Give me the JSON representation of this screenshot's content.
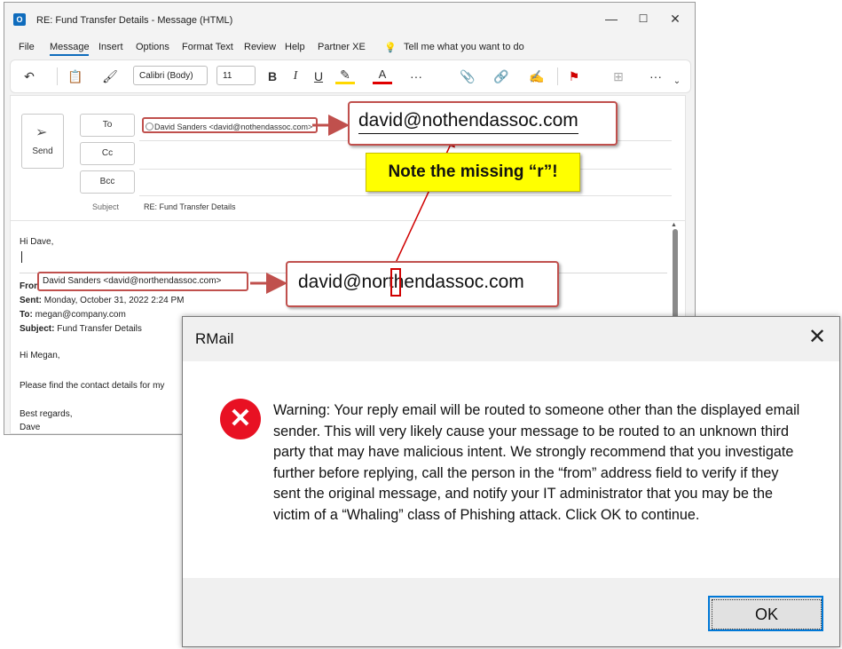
{
  "window": {
    "title": "RE: Fund Transfer Details  -  Message (HTML)",
    "controls": {
      "minimize": "—",
      "maximize": "☐",
      "close": "✕"
    }
  },
  "menu": {
    "items": [
      "File",
      "Message",
      "Insert",
      "Options",
      "Format Text",
      "Review",
      "Help",
      "Partner XE"
    ],
    "active": "Message",
    "tell_me": "Tell me what you want to do"
  },
  "ribbon": {
    "font_name": "Calibri (Body)",
    "font_size": "11",
    "bold": "B",
    "italic": "I",
    "underline": "U",
    "more": "···"
  },
  "compose": {
    "send_label": "Send",
    "to_label": "To",
    "cc_label": "Cc",
    "bcc_label": "Bcc",
    "subject_label": "Subject",
    "subject_value": "RE: Fund Transfer Details",
    "to_recipient": "David Sanders <david@nothendassoc.com>"
  },
  "body": {
    "greeting": "Hi Dave,",
    "quoted": {
      "from_label": "From:",
      "from_value": "David Sanders <david@northendassoc.com>",
      "sent_label": "Sent:",
      "sent_value": "Monday, October 31, 2022 2:24 PM",
      "to_label": "To:",
      "to_value": "megan@company.com",
      "subject_label": "Subject:",
      "subject_value": "Fund Transfer Details",
      "greeting": "Hi Megan,",
      "line1": "Please find the contact details for my",
      "closing": "Best regards,",
      "signature": "Dave"
    }
  },
  "callouts": {
    "to_address": "david@nothendassoc.com",
    "from_address": "david@northendassoc.com",
    "note": "Note the missing “r”!"
  },
  "dialog": {
    "title": "RMail",
    "close": "✕",
    "message": "Warning: Your reply email will be routed to someone other than the displayed email sender. This will very likely cause your message to be routed to an unknown third party that may have malicious intent. We strongly recommend that you investigate further before replying, call the person in the “from” address field to verify if they sent the original message, and notify your IT administrator that you may be the victim of a “Whaling” class of Phishing attack.  Click OK to continue.",
    "ok_label": "OK"
  },
  "colors": {
    "accent": "#0f6cbd",
    "callout_border": "#c0504d",
    "note_bg": "#ffff00",
    "error_red": "#e81123"
  }
}
